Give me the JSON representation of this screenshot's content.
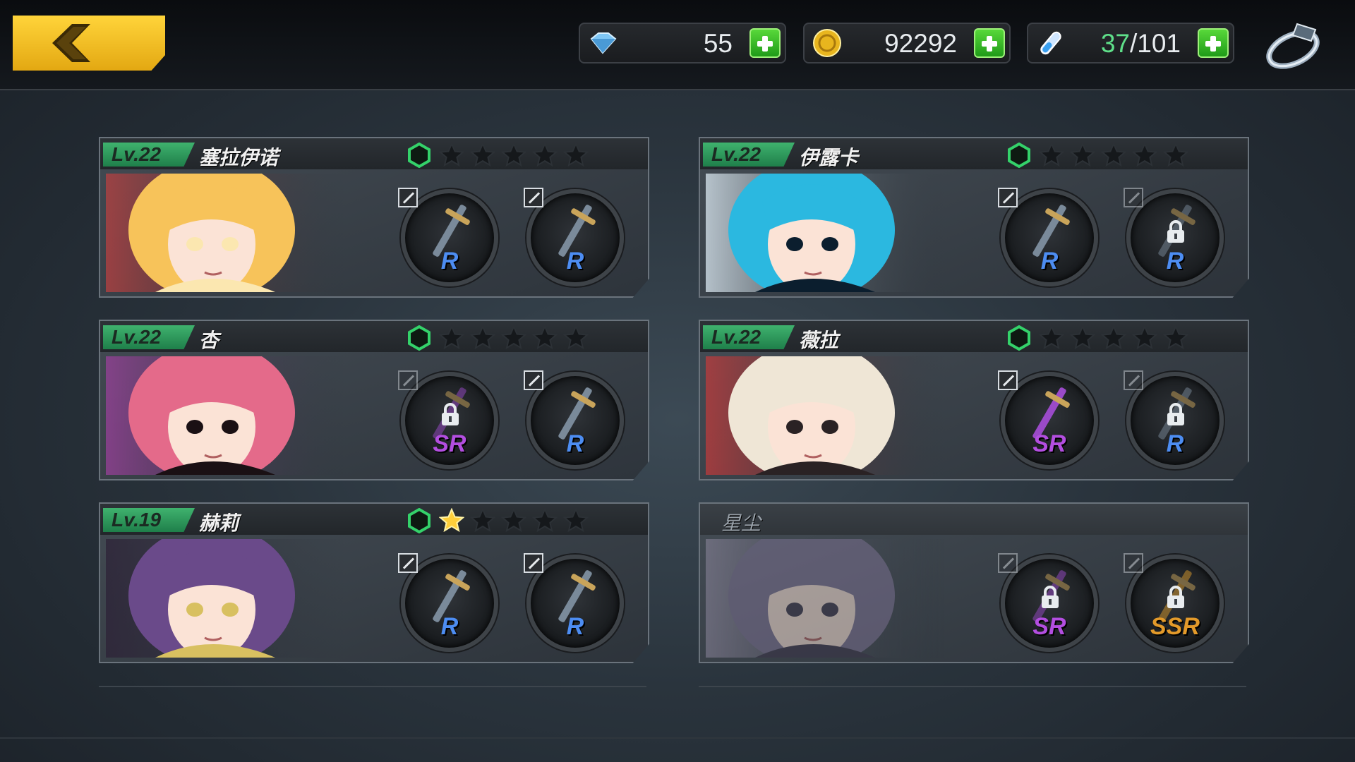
{
  "topbar": {
    "crystals": "55",
    "gold": "92292",
    "stamina_current": "37",
    "stamina_sep_max": "/101"
  },
  "icons": {
    "back": "back-arrow-icon",
    "crystal": "crystal-icon",
    "gold": "gold-coin-icon",
    "stamina": "stamina-vial-icon",
    "ring": "ring-icon"
  },
  "colors": {
    "accent_yellow": "#f5c022",
    "level_green": "#35a862",
    "rarity_r": "#4d8df2",
    "rarity_sr": "#b34ee0",
    "rarity_ssr": "#e39a2a"
  },
  "characters": [
    {
      "level": "Lv.22",
      "name": "塞拉伊诺",
      "stars": 0,
      "slots": [
        {
          "rarity": "R",
          "locked": false
        },
        {
          "rarity": "R",
          "locked": false
        }
      ]
    },
    {
      "level": "Lv.22",
      "name": "伊露卡",
      "stars": 0,
      "slots": [
        {
          "rarity": "R",
          "locked": false
        },
        {
          "rarity": "R",
          "locked": true
        }
      ]
    },
    {
      "level": "Lv.22",
      "name": "杏",
      "stars": 0,
      "slots": [
        {
          "rarity": "SR",
          "locked": true
        },
        {
          "rarity": "R",
          "locked": false
        }
      ]
    },
    {
      "level": "Lv.22",
      "name": "薇拉",
      "stars": 0,
      "slots": [
        {
          "rarity": "SR",
          "locked": false
        },
        {
          "rarity": "R",
          "locked": true
        }
      ]
    },
    {
      "level": "Lv.19",
      "name": "赫莉",
      "stars": 1,
      "slots": [
        {
          "rarity": "R",
          "locked": false
        },
        {
          "rarity": "R",
          "locked": false
        }
      ]
    },
    {
      "level": "",
      "name": "星尘",
      "stars": 0,
      "locked": true,
      "slots": [
        {
          "rarity": "SR",
          "locked": true
        },
        {
          "rarity": "SSR",
          "locked": true
        }
      ]
    }
  ]
}
